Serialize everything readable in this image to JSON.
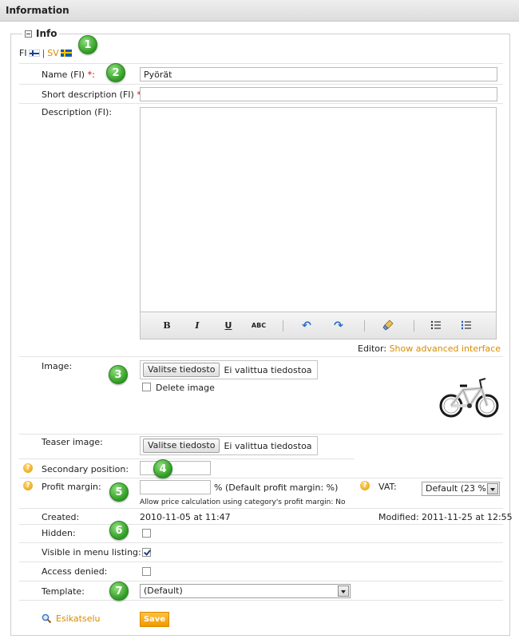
{
  "header": {
    "title": "Information"
  },
  "section": {
    "title": "Info"
  },
  "languages": {
    "fi": "FI",
    "separator": "|",
    "sv": "SV"
  },
  "badges": [
    "1",
    "2",
    "3",
    "4",
    "5",
    "6",
    "7"
  ],
  "fields": {
    "name": {
      "label": "Name (FI)",
      "required": "*:",
      "value": "Pyörät"
    },
    "short_description": {
      "label": "Short description (FI)",
      "required": "*:",
      "value": ""
    },
    "description": {
      "label": "Description (FI):"
    },
    "editor": {
      "prefix": "Editor:",
      "link": "Show advanced interface"
    },
    "image": {
      "label": "Image:",
      "button": "Valitse tiedosto",
      "file_status": "Ei valittua tiedostoa",
      "delete_label": "Delete image"
    },
    "teaser_image": {
      "label": "Teaser image:",
      "button": "Valitse tiedosto",
      "file_status": "Ei valittua tiedostoa"
    },
    "secondary_position": {
      "label": "Secondary position:",
      "value": ""
    },
    "profit_margin": {
      "label": "Profit margin:",
      "value": "",
      "suffix": "% (Default profit margin: %)",
      "note": "Allow price calculation using category's profit margin: No"
    },
    "vat": {
      "label": "VAT:",
      "selected": "Default (23 %)"
    },
    "created": {
      "label": "Created:",
      "value": "2010-11-05 at 11:47"
    },
    "modified": {
      "label": "Modified:",
      "value": "2011-11-25 at 12:55"
    },
    "hidden": {
      "label": "Hidden:",
      "checked": false
    },
    "visible_in_menu": {
      "label": "Visible in menu listing:",
      "checked": true
    },
    "access_denied": {
      "label": "Access denied:",
      "checked": false
    },
    "template": {
      "label": "Template:",
      "selected": "(Default)"
    }
  },
  "toolbar": {
    "bold": "B",
    "italic": "I",
    "underline": "U",
    "spellcheck": "ABC"
  },
  "actions": {
    "preview": "Esikatselu",
    "save": "Save"
  },
  "colors": {
    "accent": "#d98b00",
    "badge_green": "#2e9a22",
    "required": "#cc0000"
  }
}
